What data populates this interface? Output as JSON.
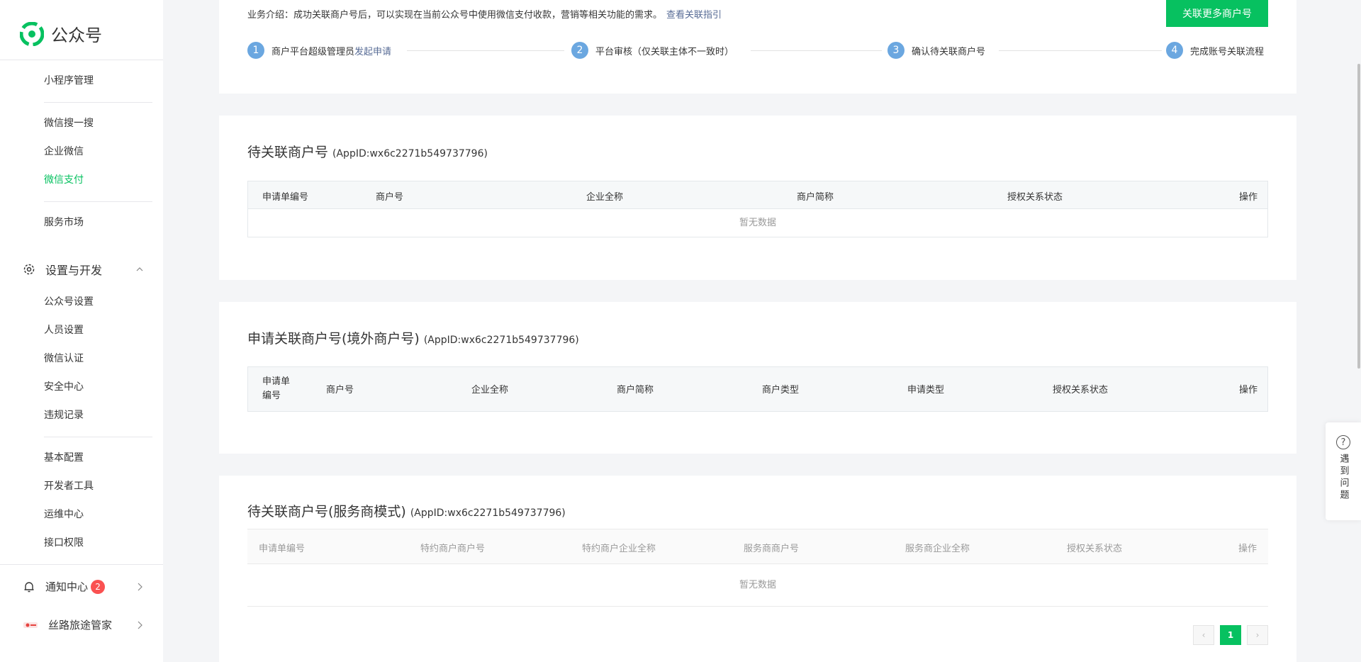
{
  "sidebar": {
    "app_name": "公众号",
    "items_group1": [
      "小程序管理"
    ],
    "items_group2": [
      "微信搜一搜",
      "企业微信",
      "微信支付"
    ],
    "items_group3": [
      "服务市场"
    ],
    "section_settings": "设置与开发",
    "items_settings": [
      "公众号设置",
      "人员设置",
      "微信认证",
      "安全中心",
      "违规记录"
    ],
    "items_dev": [
      "基本配置",
      "开发者工具",
      "运维中心",
      "接口权限"
    ],
    "notify_label": "通知中心",
    "notify_count": "2",
    "account_name": "丝路旅途管家",
    "active_item": "微信支付"
  },
  "top": {
    "intro": "业务介绍：成功关联商户号后，可以实现在当前公众号中使用微信支付收款，营销等相关功能的需求。",
    "intro_link": "查看关联指引",
    "button": "关联更多商户号",
    "steps": [
      {
        "num": "1",
        "text": "商户平台超级管理员",
        "link": "发起申请"
      },
      {
        "num": "2",
        "text": "平台审核（仅关联主体不一致时）",
        "link": ""
      },
      {
        "num": "3",
        "text": "确认待关联商户号",
        "link": ""
      },
      {
        "num": "4",
        "text": "完成账号关联流程",
        "link": ""
      }
    ]
  },
  "section1": {
    "title": "待关联商户号",
    "appid": "(AppID:wx6c2271b549737796)",
    "columns": [
      "申请单编号",
      "商户号",
      "企业全称",
      "商户简称",
      "授权关系状态",
      "操作"
    ],
    "empty": "暂无数据"
  },
  "section2": {
    "title": "申请关联商户号(境外商户号)",
    "appid": "(AppID:wx6c2271b549737796)",
    "columns": [
      "申请单编号",
      "商户号",
      "企业全称",
      "商户简称",
      "商户类型",
      "申请类型",
      "授权关系状态",
      "操作"
    ]
  },
  "section3": {
    "title": "待关联商户号(服务商模式)",
    "appid": "(AppID:wx6c2271b549737796)",
    "columns": [
      "申请单编号",
      "特约商户商户号",
      "特约商户企业全称",
      "服务商商户号",
      "服务商企业全称",
      "授权关系状态",
      "操作"
    ],
    "empty": "暂无数据",
    "pager": {
      "prev": "‹",
      "current": "1",
      "next": "›"
    }
  },
  "help": {
    "label": "遇到问题",
    "icon": "?"
  },
  "colors": {
    "brand": "#07c160",
    "link": "#576b95",
    "step": "#6ba7e0",
    "badge": "#fa5151"
  }
}
